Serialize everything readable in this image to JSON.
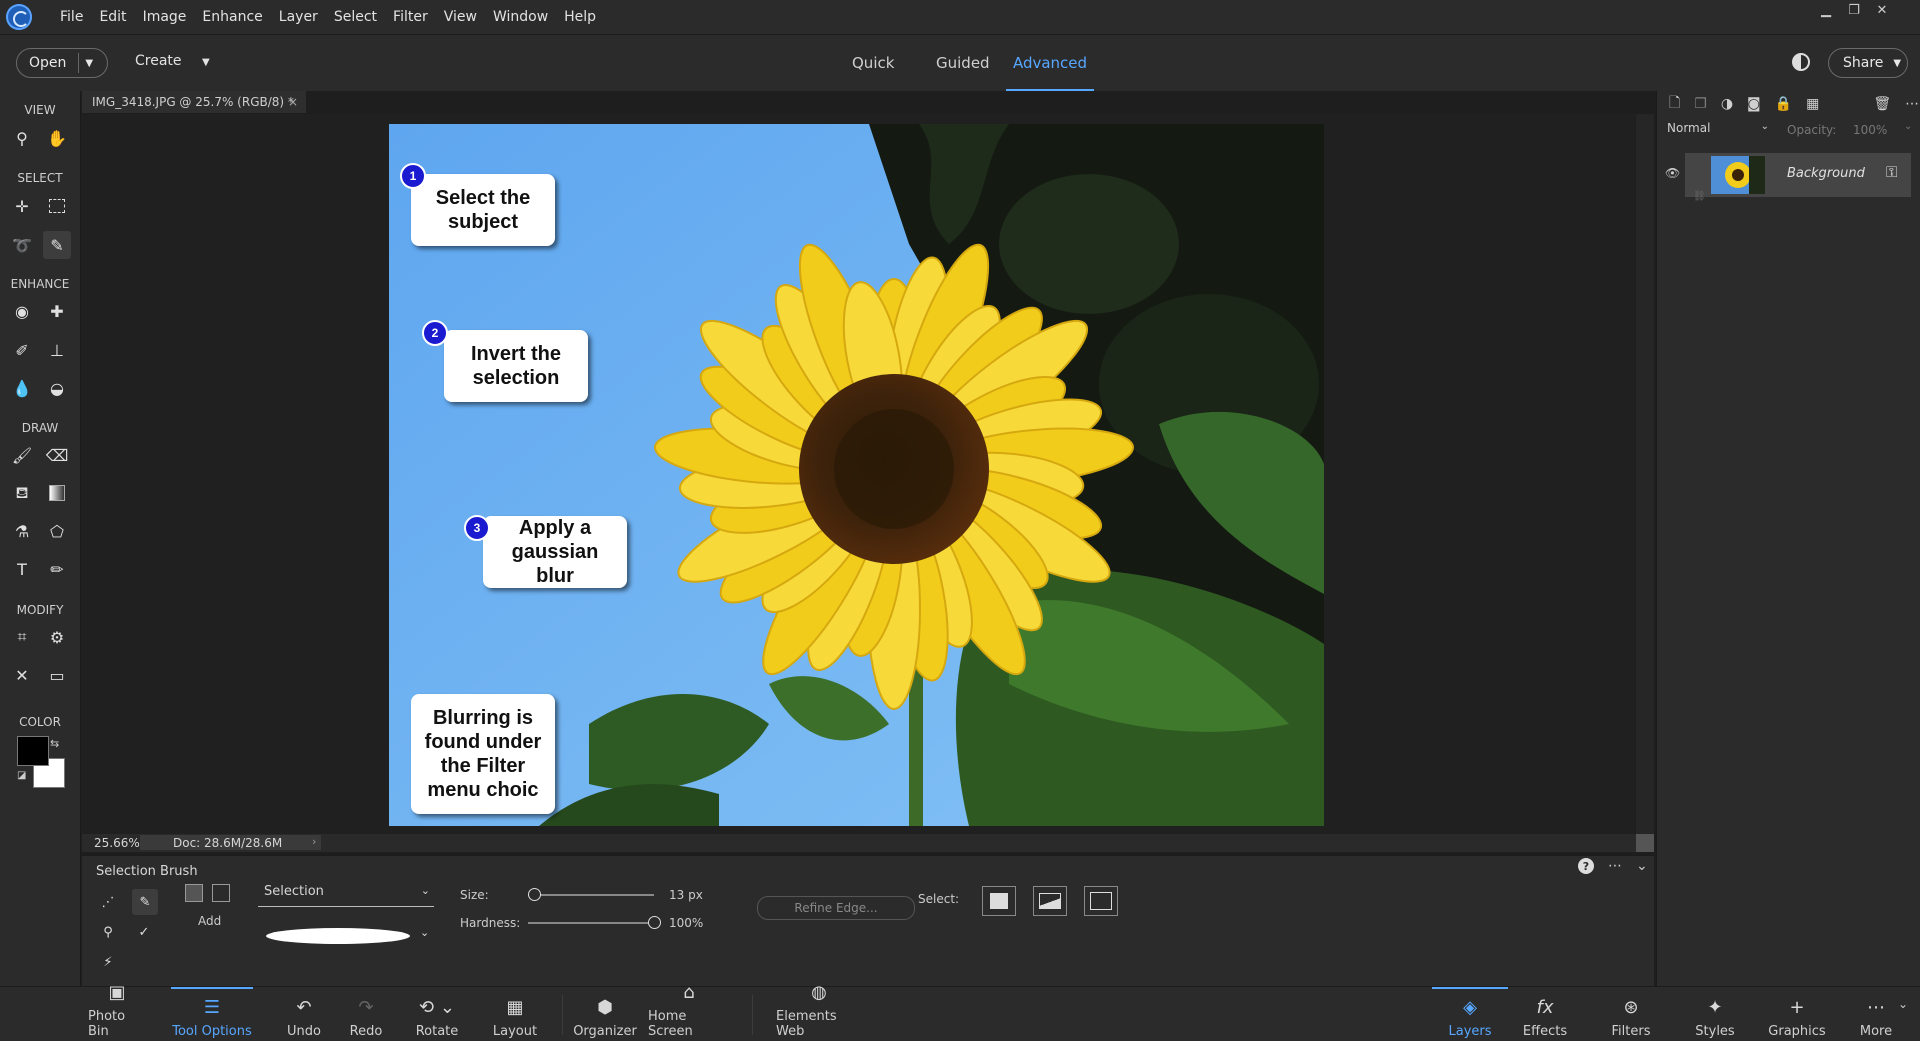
{
  "menubar": {
    "items": [
      "File",
      "Edit",
      "Image",
      "Enhance",
      "Layer",
      "Select",
      "Filter",
      "View",
      "Window",
      "Help"
    ]
  },
  "modebar": {
    "open_label": "Open",
    "create_label": "Create",
    "tabs": [
      "Quick",
      "Guided",
      "Advanced"
    ],
    "active_tab": "Advanced",
    "share_label": "Share"
  },
  "toolbar": {
    "sections": [
      "VIEW",
      "SELECT",
      "ENHANCE",
      "DRAW",
      "MODIFY",
      "COLOR"
    ]
  },
  "document": {
    "tab_title": "IMG_3418.JPG @ 25.7% (RGB/8) *",
    "zoom": "25.66%",
    "doc_size": "Doc: 28.6M/28.6M"
  },
  "callouts": [
    {
      "num": "1",
      "text": "Select the subject"
    },
    {
      "num": "2",
      "text": "Invert the selection"
    },
    {
      "num": "3",
      "text": "Apply a gaussian blur"
    },
    {
      "num": "",
      "text": "Blurring is found under the Filter menu choic"
    }
  ],
  "layers": {
    "blend_mode": "Normal",
    "opacity_label": "Opacity:",
    "opacity_value": "100%",
    "layer_name": "Background"
  },
  "tool_options": {
    "tool_name": "Selection Brush",
    "mode_label": "Add",
    "selection_type": "Selection",
    "size_label": "Size:",
    "size_value": "13 px",
    "size_level": 0.05,
    "hardness_label": "Hardness:",
    "hardness_value": "100%",
    "hardness_level": 1.0,
    "refine_edge": "Refine Edge...",
    "select_label": "Select:"
  },
  "bottombar": {
    "items": [
      "Photo Bin",
      "Tool Options",
      "Undo",
      "Redo",
      "Rotate",
      "Layout",
      "Organizer",
      "Home Screen",
      "Elements Web"
    ],
    "right_items": [
      "Layers",
      "Effects",
      "Filters",
      "Styles",
      "Graphics",
      "More"
    ]
  },
  "colors": {
    "accent": "#57a7ff",
    "sky": "#6fb4f2",
    "petal": "#f5d21c",
    "badge": "#1a1ad0"
  }
}
